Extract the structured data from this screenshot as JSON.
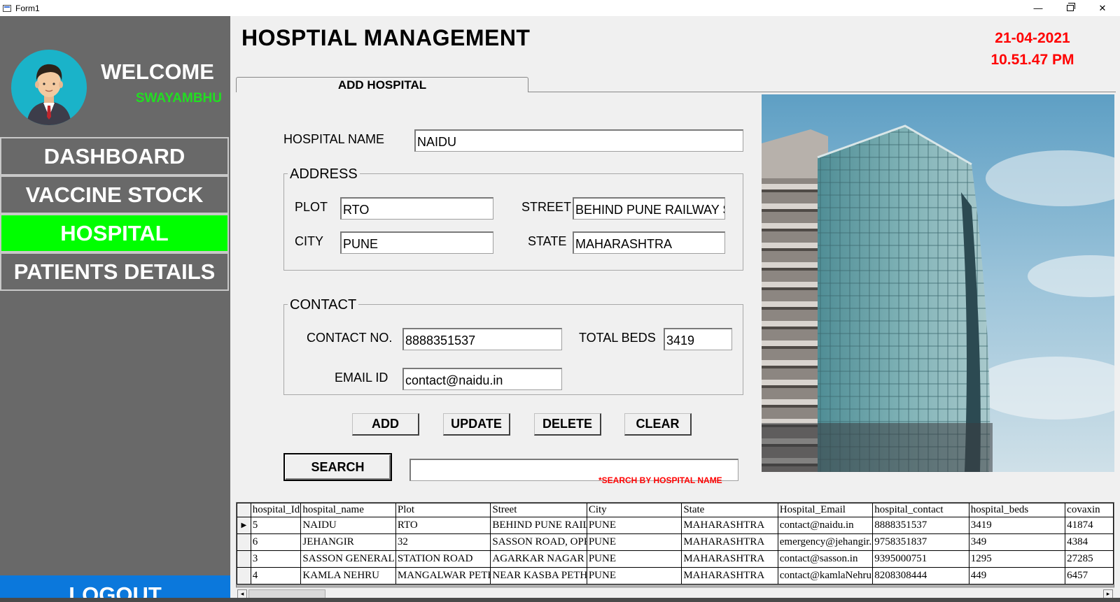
{
  "window": {
    "title": "Form1",
    "minimize": "—",
    "close": "✕"
  },
  "sidebar": {
    "welcome": "WELCOME",
    "username": "SWAYAMBHU",
    "nav": [
      {
        "label": "DASHBOARD",
        "active": false
      },
      {
        "label": "VACCINE STOCK",
        "active": false
      },
      {
        "label": "HOSPITAL",
        "active": true
      },
      {
        "label": "PATIENTS DETAILS",
        "active": false
      }
    ],
    "logout": "LOGOUT",
    "active_color": "#00ff00",
    "logout_color": "#0b78dc"
  },
  "header": {
    "title": "HOSPTIAL MANAGEMENT",
    "date": "21-04-2021",
    "time": "10.51.47 PM",
    "datetime_color": "#ff0000"
  },
  "tab": {
    "label": "ADD HOSPITAL"
  },
  "form": {
    "hospital_name_label": "HOSPITAL NAME",
    "hospital_name": "NAIDU",
    "address_title": "ADDRESS",
    "plot_label": "PLOT",
    "plot": "RTO",
    "street_label": "STREET",
    "street": "BEHIND PUNE RAILWAY STATION",
    "city_label": "CITY",
    "city": "PUNE",
    "state_label": "STATE",
    "state": "MAHARASHTRA",
    "contact_title": "CONTACT",
    "contact_label": "CONTACT NO.",
    "contact": "8888351537",
    "beds_label": "TOTAL BEDS",
    "beds": "3419",
    "email_label": "EMAIL ID",
    "email": "contact@naidu.in"
  },
  "buttons": {
    "add": "ADD",
    "update": "UPDATE",
    "delete": "DELETE",
    "clear": "CLEAR",
    "search": "SEARCH"
  },
  "search": {
    "value": "",
    "hint": "*SEARCH BY HOSPITAL NAME"
  },
  "grid": {
    "columns": [
      "hospital_Id",
      "hospital_name",
      "Plot",
      "Street",
      "City",
      "State",
      "Hospital_Email",
      "hospital_contact",
      "hospital_beds",
      "covaxin"
    ],
    "rows": [
      [
        "5",
        "NAIDU",
        "RTO",
        "BEHIND PUNE RAILWAY STATION",
        "PUNE",
        "MAHARASHTRA",
        "contact@naidu.in",
        "8888351537",
        "3419",
        "41874"
      ],
      [
        "6",
        "JEHANGIR",
        "32",
        "SASSON ROAD, OPP",
        "PUNE",
        "MAHARASHTRA",
        "emergency@jehangir.in",
        "9758351837",
        "349",
        "4384"
      ],
      [
        "3",
        "SASSON GENERAL",
        "STATION ROAD",
        "AGARKAR NAGAR",
        "PUNE",
        "MAHARASHTRA",
        "contact@sasson.in",
        "9395000751",
        "1295",
        "27285"
      ],
      [
        "4",
        "KAMLA NEHRU",
        "MANGALWAR PETH",
        "NEAR KASBA PETH",
        "PUNE",
        "MAHARASHTRA",
        "contact@kamlaNehru.in",
        "8208308444",
        "449",
        "6457"
      ]
    ],
    "selected_row": 0,
    "selected_marker": "▶"
  }
}
